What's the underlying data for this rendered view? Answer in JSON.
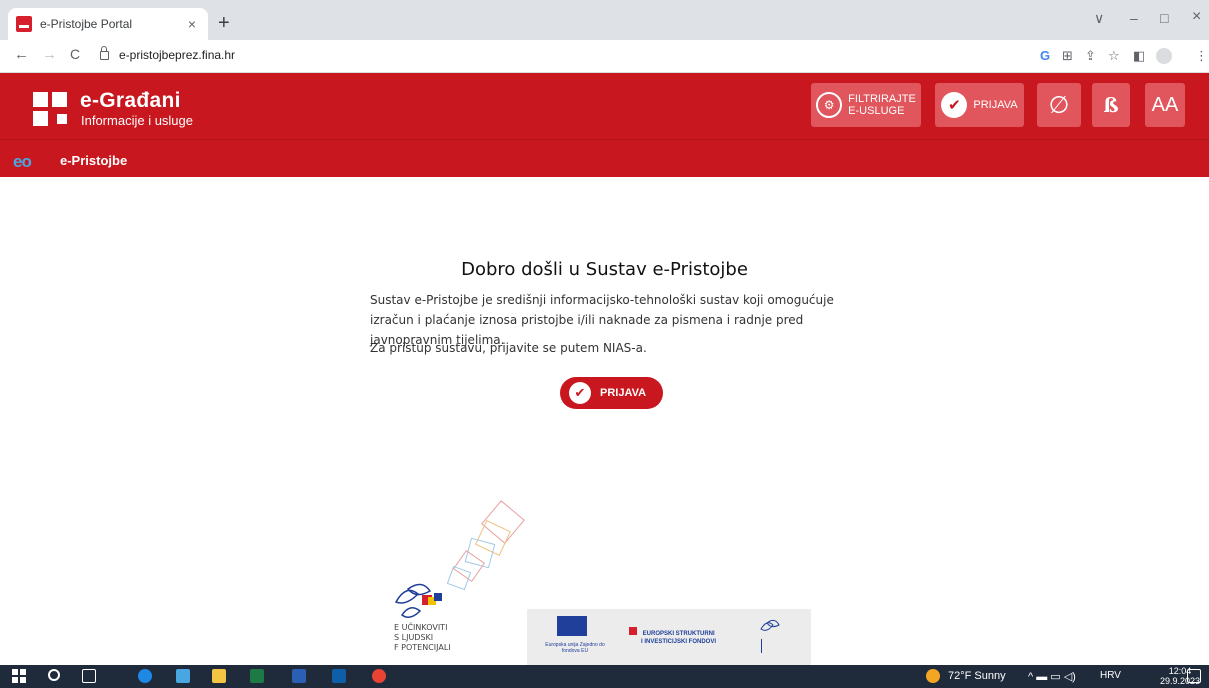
{
  "browser": {
    "tab_title": "e-Pristojbe Portal",
    "tab_close": "×",
    "new_tab": "+",
    "url": "e-pristojbeprez.fina.hr",
    "nav": {
      "back": "←",
      "forward": "→",
      "reload": "C"
    },
    "window": {
      "minimize": "–",
      "maximize": "□",
      "close": "×",
      "dropdown": "∨"
    },
    "toolbar_icons": [
      "google-icon",
      "translate-icon",
      "share-icon",
      "star-icon",
      "sidepanel-icon",
      "profile-icon",
      "menu-icon"
    ]
  },
  "header": {
    "brand_name": "e-Građani",
    "brand_sub": "Informacije i usluge",
    "filter_label_line1": "FILTRIRAJTE",
    "filter_label_line2": "E-USLUGE",
    "login_label": "PRIJAVA",
    "contrast_icon_glyph": "∅",
    "dyslexia_icon_glyph": "ß",
    "font_size_label": "AA",
    "subnav_logo": "eo",
    "subnav_title": "e-Pristojbe"
  },
  "main": {
    "title": "Dobro došli u Sustav e-Pristojbe",
    "paragraph1": "Sustav e-Pristojbe je središnji informacijsko-tehnološki sustav koji omogućuje izračun i plaćanje iznosa pristojbe i/ili naknade za pismena i radnje pred javnopravnim tijelima.",
    "paragraph2": "Za pristup sustavu, prijavite se putem NIAS-a.",
    "login_button": "PRIJAVA"
  },
  "footer": {
    "esf_line1": "E  UČINKOVITI",
    "esf_line2": "S  LJUDSKI",
    "esf_line3": "F  POTENCIJALI",
    "eu_caption": "Europska unija Zajedno do fondova EU",
    "struct_line1": "EUROPSKI STRUKTURNI",
    "struct_line2": "I INVESTICIJSKI FONDOVI"
  },
  "taskbar": {
    "weather": "72°F  Sunny",
    "language": "HRV",
    "time": "12:04",
    "date": "29.9.2023"
  },
  "colors": {
    "brand_red": "#c8171f",
    "button_light_red": "#e0565c",
    "taskbar": "#1f2a3b"
  }
}
